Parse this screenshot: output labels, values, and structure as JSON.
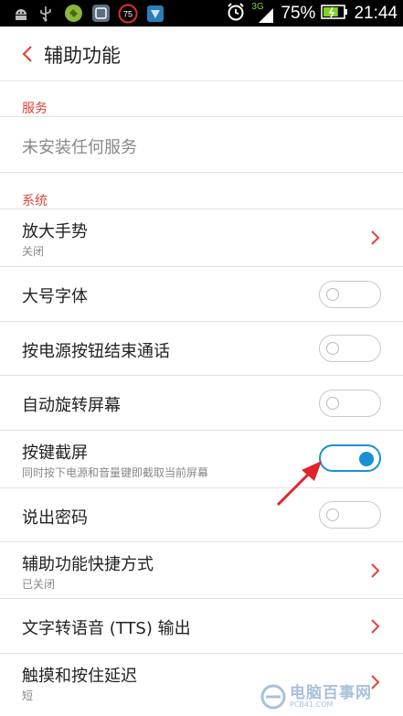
{
  "statusbar": {
    "battery_percent": "75%",
    "time": "21:44",
    "network": "3G",
    "notification_badge": "75",
    "battery_level": 0.75
  },
  "header": {
    "title": "辅助功能"
  },
  "sections": {
    "services_title": "服务",
    "services_empty": "未安装任何服务",
    "system_title": "系统"
  },
  "rows": [
    {
      "title": "放大手势",
      "subtitle": "关闭",
      "control": "chevron"
    },
    {
      "title": "大号字体",
      "control": "toggle",
      "on": false
    },
    {
      "title": "按电源按钮结束通话",
      "control": "toggle",
      "on": false
    },
    {
      "title": "自动旋转屏幕",
      "control": "toggle",
      "on": false
    },
    {
      "title": "按键截屏",
      "subtitle": "同时按下电源和音量键即截取当前屏幕",
      "control": "toggle",
      "on": true
    },
    {
      "title": "说出密码",
      "control": "toggle",
      "on": false
    },
    {
      "title": "辅助功能快捷方式",
      "subtitle": "已关闭",
      "control": "chevron"
    },
    {
      "title": "文字转语音 (TTS) 输出",
      "control": "chevron"
    },
    {
      "title": "触摸和按住延迟",
      "subtitle": "短",
      "control": "chevron"
    }
  ],
  "watermark": {
    "cn": "电脑百事网",
    "en": "PCB41.COM"
  },
  "colors": {
    "accent": "#e0443a",
    "toggle_on": "#1a8fd6",
    "annotation": "#e0252a"
  }
}
